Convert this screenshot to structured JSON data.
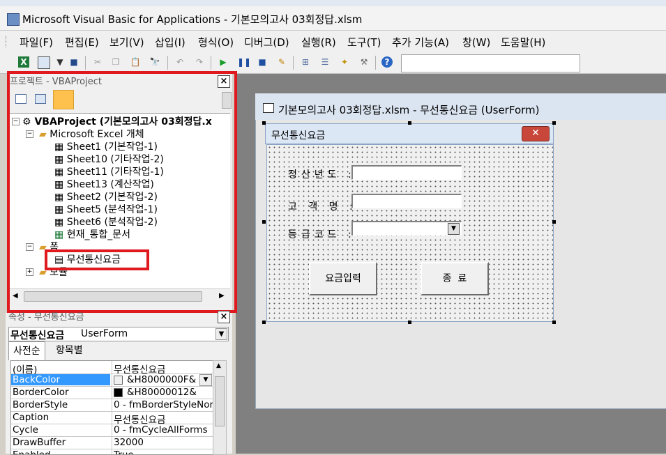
{
  "window": {
    "title": "Microsoft Visual Basic for Applications - 기본모의고사 03회정답.xlsm"
  },
  "menu": [
    "파일(F)",
    "편집(E)",
    "보기(V)",
    "삽입(I)",
    "형식(O)",
    "디버그(D)",
    "실행(R)",
    "도구(T)",
    "추가 기능(A)",
    "창(W)",
    "도움말(H)"
  ],
  "toolbar": {
    "icons": [
      "excel-icon",
      "insert-userform-icon",
      "dropdown-arrow-icon",
      "save-icon",
      "cut-icon",
      "copy-icon",
      "paste-icon",
      "find-icon",
      "undo-icon",
      "redo-icon",
      "run-icon",
      "break-icon",
      "reset-icon",
      "design-mode-icon",
      "project-explorer-icon",
      "properties-icon",
      "object-browser-icon",
      "toolbox-icon",
      "help-icon"
    ]
  },
  "project_pane": {
    "title": "프로젝트 - VBAProject",
    "tree": {
      "root": "VBAProject (기본모의고사 03회정답.x",
      "folder_excel": "Microsoft Excel 개체",
      "sheets": [
        "Sheet1 (기본작업-1)",
        "Sheet10 (기타작업-2)",
        "Sheet11 (기타작업-1)",
        "Sheet13 (계산작업)",
        "Sheet2 (기본작업-2)",
        "Sheet5 (분석작업-1)",
        "Sheet6 (분석작업-2)",
        "현재_통합_문서"
      ],
      "folder_forms": "폼",
      "form_item": "무선통신요금",
      "folder_modules": "모듈"
    }
  },
  "properties_pane": {
    "title": "속성 - 무선통신요금",
    "object_name": "무선통신요금",
    "object_type": "UserForm",
    "tabs": [
      "사전순",
      "항목별"
    ],
    "rows": [
      {
        "key": "(이름)",
        "value": "무선통신요금"
      },
      {
        "key": "BackColor",
        "value": "&H8000000F&"
      },
      {
        "key": "BorderColor",
        "value": "&H80000012&"
      },
      {
        "key": "BorderStyle",
        "value": "0 - fmBorderStyleNor"
      },
      {
        "key": "Caption",
        "value": "무선통신요금"
      },
      {
        "key": "Cycle",
        "value": "0 - fmCycleAllForms"
      },
      {
        "key": "DrawBuffer",
        "value": "32000"
      },
      {
        "key": "Enabled",
        "value": "True"
      }
    ],
    "colors": {
      "backcolor_swatch": "#f0f0f0",
      "bordercolor_swatch": "#000000",
      "selected_row": "#3399ff"
    }
  },
  "designer": {
    "title": "기본모의고사 03회정답.xlsm - 무선통신요금 (UserForm)",
    "form": {
      "caption": "무선통신요금",
      "fields": [
        {
          "label": "정산년도 :",
          "type": "textbox"
        },
        {
          "label": "고 객 명 :",
          "type": "textbox"
        },
        {
          "label": "등급코드 :",
          "type": "combobox"
        }
      ],
      "buttons": [
        "요금입력",
        "종  료"
      ]
    }
  },
  "colors": {
    "highlight_red": "#e0191f",
    "tree_select": "#0a246a"
  }
}
